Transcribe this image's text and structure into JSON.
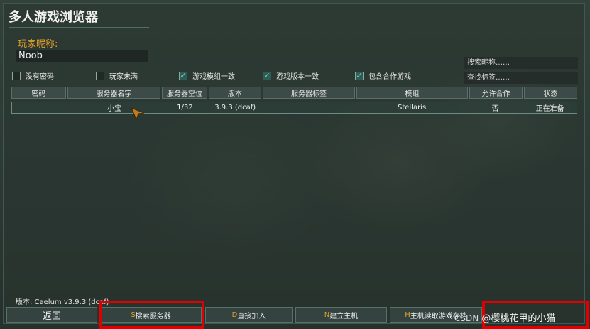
{
  "window": {
    "title": "多人游戏浏览器"
  },
  "nickname": {
    "label": "玩家昵称:",
    "value": "Noob"
  },
  "search": {
    "nick_placeholder": "搜索昵称……",
    "tag_placeholder": "查找标签……"
  },
  "filters": [
    {
      "label": "没有密码",
      "checked": false
    },
    {
      "label": "玩家未满",
      "checked": false
    },
    {
      "label": "游戏模组一致",
      "checked": true
    },
    {
      "label": "游戏版本一致",
      "checked": true
    },
    {
      "label": "包含合作游戏",
      "checked": true
    }
  ],
  "table": {
    "headers": [
      "密码",
      "服务器名字",
      "服务器空位",
      "版本",
      "服务器标签",
      "模组",
      "允许合作",
      "状态"
    ],
    "rows": [
      {
        "password": "",
        "name": "小宝",
        "slots": "1/32",
        "version": "3.9.3 (dcaf)",
        "tags": "",
        "mod": "Stellaris",
        "coop": "否",
        "status": "正在准备"
      }
    ]
  },
  "footer": {
    "version_text": "版本: Caelum v3.9.3 (dcaf)",
    "back_label": "返回",
    "buttons": [
      {
        "hotkey": "S",
        "label": "搜索服务器"
      },
      {
        "hotkey": "D",
        "label": "直接加入"
      },
      {
        "hotkey": "N",
        "label": "建立主机"
      },
      {
        "hotkey": "H",
        "label": "主机读取游戏存档"
      }
    ]
  },
  "watermark": {
    "prefix": "CSDN",
    "text": "@樱桃花甲的小猫"
  },
  "colors": {
    "accent": "#e2a02a",
    "highlight": "#e00000",
    "check": "#7fd0c0"
  }
}
